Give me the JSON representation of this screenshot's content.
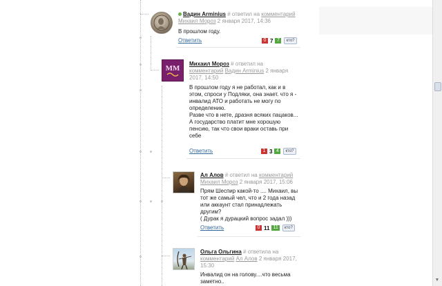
{
  "comments": [
    {
      "author": "Вадин Arminius",
      "online": true,
      "reply_prefix": "# ответил на",
      "reply_target_link": "комментарий",
      "reply_target_author": "Михаил Мороз",
      "date": "2 января 2017, 14:36",
      "text": "В прошлом году.",
      "reply_label": "Ответить",
      "votes": {
        "minus": "0",
        "total": "7",
        "plus": "7"
      },
      "kto_label": "кто?",
      "avatar": "coin-avatar"
    },
    {
      "author": "Михаил Мороз",
      "online": false,
      "reply_prefix": "# ответил на",
      "reply_target_link": "комментарий",
      "reply_target_author": "Вадин Arminius",
      "date": "2 января 2017, 14:50",
      "text": "В прошлом году я не работал, как и в этом, спроси у Подляки, она знает. что я - инвалид АТО и работать не могу по определению.\nРазве что в нете, дразня всяких пацаков...\nА государство платит мне хорошую пенсию, так что свои враки оставь при себе",
      "reply_label": "Ответить",
      "votes": {
        "minus": "1",
        "total": "3",
        "plus": "4"
      },
      "kto_label": "кто?",
      "avatar": "mm-logo-avatar"
    },
    {
      "author": "Ал Алов",
      "online": false,
      "reply_prefix": "# ответил на",
      "reply_target_link": "комментарий",
      "reply_target_author": "Михаил Мороз",
      "date": "2 января 2017, 15:06",
      "text": "Прям Шеспир какой-то .... Михаил, вы тот же самый чел, что и 2 года назад или аккаунт стал принадлежать другим?\n( Дурак я дурацкий вопрос задал )))",
      "reply_label": "Ответить",
      "votes": {
        "minus": "0",
        "total": "11",
        "plus": "11"
      },
      "kto_label": "кто?",
      "avatar": "portrait-avatar"
    },
    {
      "author": "Ольга Ольгина",
      "online": false,
      "reply_prefix": "# ответила на",
      "reply_target_link": "комментарий",
      "reply_target_author": "Ал Алов",
      "date": "2 января 2017, 15:30",
      "text": "Инвалид он на голову....что весьма заметно..",
      "avatar": "archer-avatar"
    }
  ],
  "colors": {
    "link": "#336699",
    "minus": "#cc3333",
    "plus": "#55a840",
    "meta": "#999999"
  }
}
